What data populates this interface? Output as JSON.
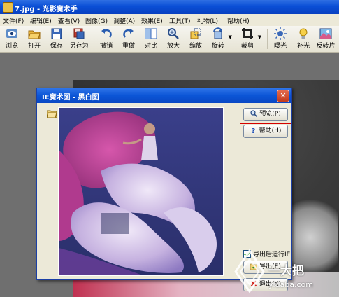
{
  "window": {
    "title": "7.jpg - 光影魔术手"
  },
  "menu": [
    "文件(F)",
    "编辑(E)",
    "查看(V)",
    "图像(G)",
    "调整(A)",
    "效果(E)",
    "工具(T)",
    "礼物(L)",
    "帮助(H)"
  ],
  "toolbar": [
    {
      "label": "浏览",
      "icon": "eye-icon"
    },
    {
      "label": "打开",
      "icon": "folder-open-icon"
    },
    {
      "label": "保存",
      "icon": "save-icon"
    },
    {
      "label": "另存为",
      "icon": "save-as-icon"
    },
    {
      "label": "撤销",
      "icon": "undo-icon"
    },
    {
      "label": "重做",
      "icon": "redo-icon"
    },
    {
      "label": "对比",
      "icon": "compare-icon"
    },
    {
      "label": "放大",
      "icon": "zoom-in-icon"
    },
    {
      "label": "缩放",
      "icon": "resize-icon"
    },
    {
      "label": "旋转",
      "icon": "rotate-icon"
    },
    {
      "label": "裁剪",
      "icon": "crop-icon"
    },
    {
      "label": "曝光",
      "icon": "exposure-icon"
    },
    {
      "label": "补光",
      "icon": "fill-light-icon"
    },
    {
      "label": "反转片",
      "icon": "reversal-film-icon"
    }
  ],
  "dialog": {
    "title": "IE魔术图 - 黑白图",
    "close_icon": "close-icon",
    "preview_label": "预览(P)",
    "help_label": "帮助(H)",
    "run_ie_label": "导出后运行IE",
    "run_ie_checked": true,
    "export_label": "导出(E)",
    "exit_label": "退出(X)"
  },
  "watermark": {
    "brand": "一大把",
    "url": "yidaba.com"
  },
  "colors": {
    "titlebar": "#0a4fd6",
    "dialog_bg": "#ece9d8",
    "highlight": "#d40000"
  }
}
